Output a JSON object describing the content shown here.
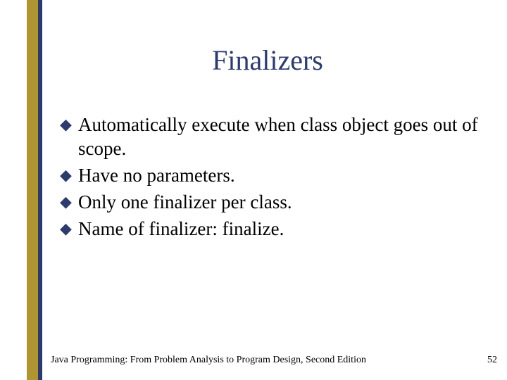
{
  "title": "Finalizers",
  "bullets": [
    "Automatically execute when class object goes out of scope.",
    "Have no parameters.",
    "Only one finalizer per class.",
    "Name of finalizer: finalize."
  ],
  "footer": {
    "source": "Java Programming: From Problem Analysis to Program Design, Second Edition",
    "page": "52"
  },
  "bullet_glyph": "◆"
}
